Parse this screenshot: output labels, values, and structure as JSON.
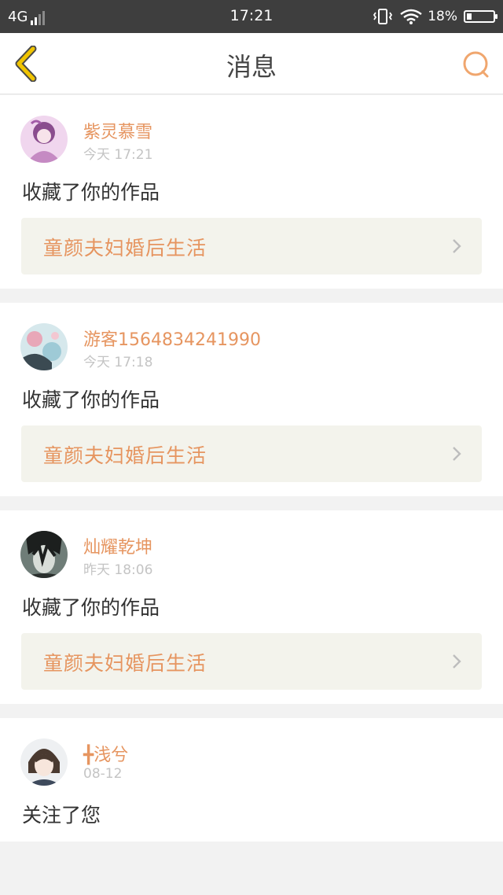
{
  "status_bar": {
    "network": "4G",
    "time": "17:21",
    "battery": "18%",
    "battery_level": 0.18
  },
  "nav": {
    "title": "消息",
    "back_icon": "chevron-left-icon",
    "search_icon": "search-icon"
  },
  "messages": [
    {
      "username": "紫灵慕雪",
      "time": "今天 17:21",
      "action": "收藏了你的作品",
      "work_title": "童颜夫妇婚后生活"
    },
    {
      "username": "游客1564834241990",
      "time": "今天 17:18",
      "action": "收藏了你的作品",
      "work_title": "童颜夫妇婚后生活"
    },
    {
      "username": "灿耀乾坤",
      "time": "昨天 18:06",
      "action": "收藏了你的作品",
      "work_title": "童颜夫妇婚后生活"
    },
    {
      "username": "╋浅兮",
      "time": "08-12",
      "action": "关注了您"
    }
  ],
  "colors": {
    "accent": "#e69560",
    "back_icon": "#f0c400",
    "status_bar": "#3e3e3e",
    "work_box_bg": "#f3f3ec"
  }
}
